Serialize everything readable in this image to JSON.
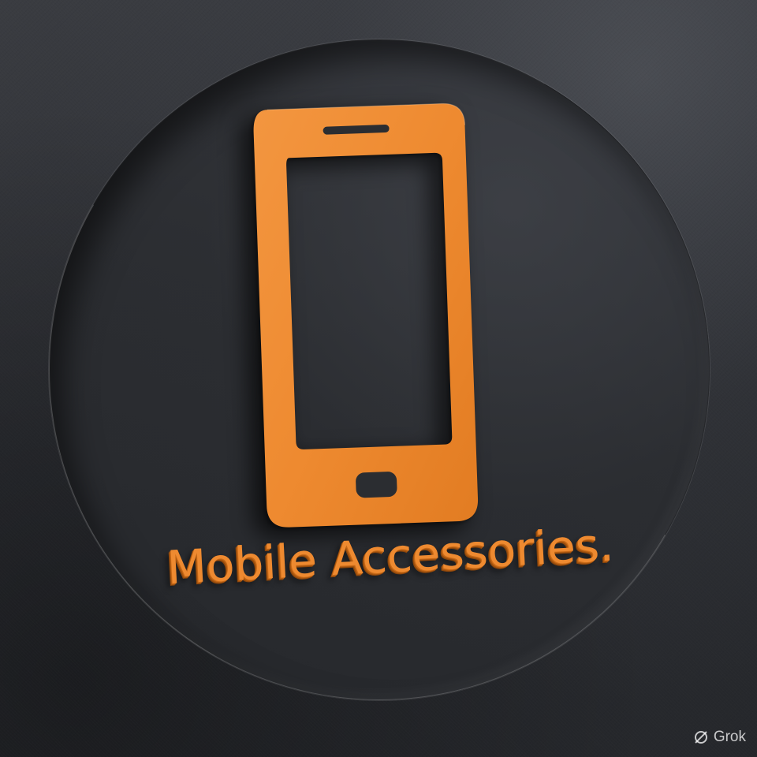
{
  "logo": {
    "brand_text": "Mobile Accessories.",
    "icon": "smartphone-icon",
    "accent_color": "#EE8A30",
    "background_color": "#2B2D31"
  },
  "watermark": {
    "text": "Grok",
    "icon": "grok-logo-icon"
  }
}
